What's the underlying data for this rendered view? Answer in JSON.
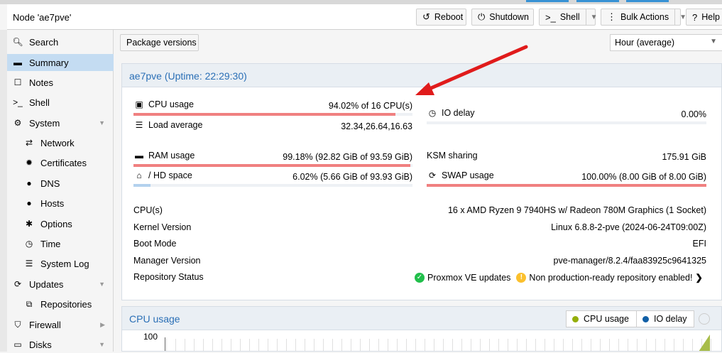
{
  "header": {
    "title": "Node 'ae7pve'",
    "buttons": {
      "reboot": "Reboot",
      "shutdown": "Shutdown",
      "shell": "Shell",
      "bulk_actions": "Bulk Actions",
      "help": "Help"
    }
  },
  "sidebar": {
    "items": [
      {
        "label": "Search",
        "icon": "search-icon"
      },
      {
        "label": "Summary",
        "icon": "book-icon",
        "selected": true
      },
      {
        "label": "Notes",
        "icon": "note-icon"
      },
      {
        "label": "Shell",
        "icon": "terminal-icon"
      },
      {
        "label": "System",
        "icon": "gears-icon"
      },
      {
        "label": "Network",
        "icon": "exchange-icon"
      },
      {
        "label": "Certificates",
        "icon": "certificate-icon"
      },
      {
        "label": "DNS",
        "icon": "globe-icon"
      },
      {
        "label": "Hosts",
        "icon": "globe-icon"
      },
      {
        "label": "Options",
        "icon": "gear-icon"
      },
      {
        "label": "Time",
        "icon": "clock-icon"
      },
      {
        "label": "System Log",
        "icon": "list-icon"
      },
      {
        "label": "Updates",
        "icon": "refresh-icon"
      },
      {
        "label": "Repositories",
        "icon": "files-icon"
      },
      {
        "label": "Firewall",
        "icon": "shield-icon"
      },
      {
        "label": "Disks",
        "icon": "hdd-icon"
      }
    ]
  },
  "toolbar": {
    "package_versions": "Package versions",
    "timeframe": "Hour (average)"
  },
  "status": {
    "title": "ae7pve (Uptime: 22:29:30)",
    "cpu": {
      "label": "CPU usage",
      "value": "94.02% of 16 CPU(s)",
      "percent": 94.02
    },
    "io_delay": {
      "label": "IO delay",
      "value": "0.00%",
      "percent": 0
    },
    "load": {
      "label": "Load average",
      "value": "32.34,26.64,16.63"
    },
    "ram": {
      "label": "RAM usage",
      "value": "99.18% (92.82 GiB of 93.59 GiB)",
      "percent": 99.18
    },
    "ksm": {
      "label": "KSM sharing",
      "value": "175.91 GiB"
    },
    "hd": {
      "label": "/ HD space",
      "value": "6.02% (5.66 GiB of 93.93 GiB)",
      "percent": 6.02
    },
    "swap": {
      "label": "SWAP usage",
      "value": "100.00% (8.00 GiB of 8.00 GiB)",
      "percent": 100
    },
    "cpus": {
      "label": "CPU(s)",
      "value": "16 x AMD Ryzen 9 7940HS w/ Radeon 780M Graphics (1 Socket)"
    },
    "kernel": {
      "label": "Kernel Version",
      "value": "Linux 6.8.8-2-pve (2024-06-24T09:00Z)"
    },
    "boot": {
      "label": "Boot Mode",
      "value": "EFI"
    },
    "manager": {
      "label": "Manager Version",
      "value": "pve-manager/8.2.4/faa83925c9641325"
    },
    "repo": {
      "label": "Repository Status",
      "ok": "Proxmox VE updates",
      "warn": "Non production-ready repository enabled!"
    }
  },
  "chart": {
    "title": "CPU usage",
    "legend": [
      "CPU usage",
      "IO delay"
    ],
    "ytick": "100"
  },
  "colors": {
    "bar_critical": "#f08080",
    "bar_ok": "#b3d1ee",
    "accent": "#2a6fb6",
    "legend_cpu": "#94ae0a",
    "legend_io": "#115fa6",
    "annotation_arrow": "#e01b1b"
  }
}
